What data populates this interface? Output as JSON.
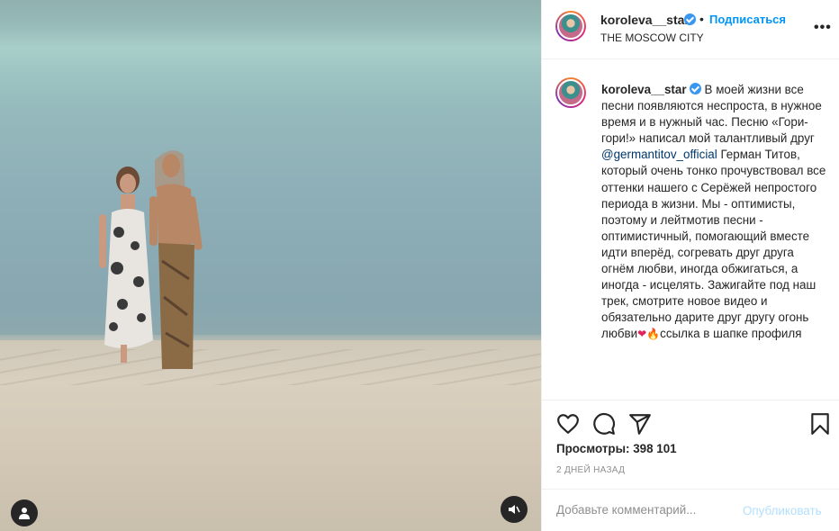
{
  "header": {
    "username": "koroleva__star",
    "follow_label": "Подписаться",
    "separator": "•",
    "location": "THE MOSCOW CITY",
    "more_label": "•••"
  },
  "caption": {
    "username": "koroleva__star",
    "text_1": "В моей жизни все песни появляются неспроста, в нужное время и в нужный час. Песню «Гори-гори!» написал мой талантливый друг ",
    "mention": "@germantitov_official",
    "text_2": " Герман Титов, который очень тонко прочувствовал все оттенки нашего с Серёжей непростого периода в жизни. Мы - оптимисты, поэтому и лейтмотив песни - оптимистичный, помогающий вместе идти вперёд, согревать друг друга огнём любви, иногда обжигаться, а иногда - исцелять. Зажигайте под наш трек, смотрите новое видео и обязательно дарите друг другу огонь любви",
    "emoji_heart": "❤",
    "emoji_fire": "🔥",
    "text_3": "ссылка в шапке профиля"
  },
  "stats": {
    "views_label": "Просмотры:",
    "views_value": "398 101",
    "date": "2 ДНЕЙ НАЗАД"
  },
  "comment": {
    "placeholder": "Добавьте комментарий...",
    "post_label": "Опубликовать"
  },
  "icons": {
    "like": "heart-icon",
    "comment": "comment-icon",
    "share": "paper-plane-icon",
    "save": "bookmark-icon",
    "tag": "user-tag-icon",
    "mute": "speaker-muted-icon"
  },
  "colors": {
    "link_blue": "#0095f6",
    "mention": "#00376b",
    "muted": "#8e8e8e",
    "post_disabled": "#b2dffc"
  }
}
